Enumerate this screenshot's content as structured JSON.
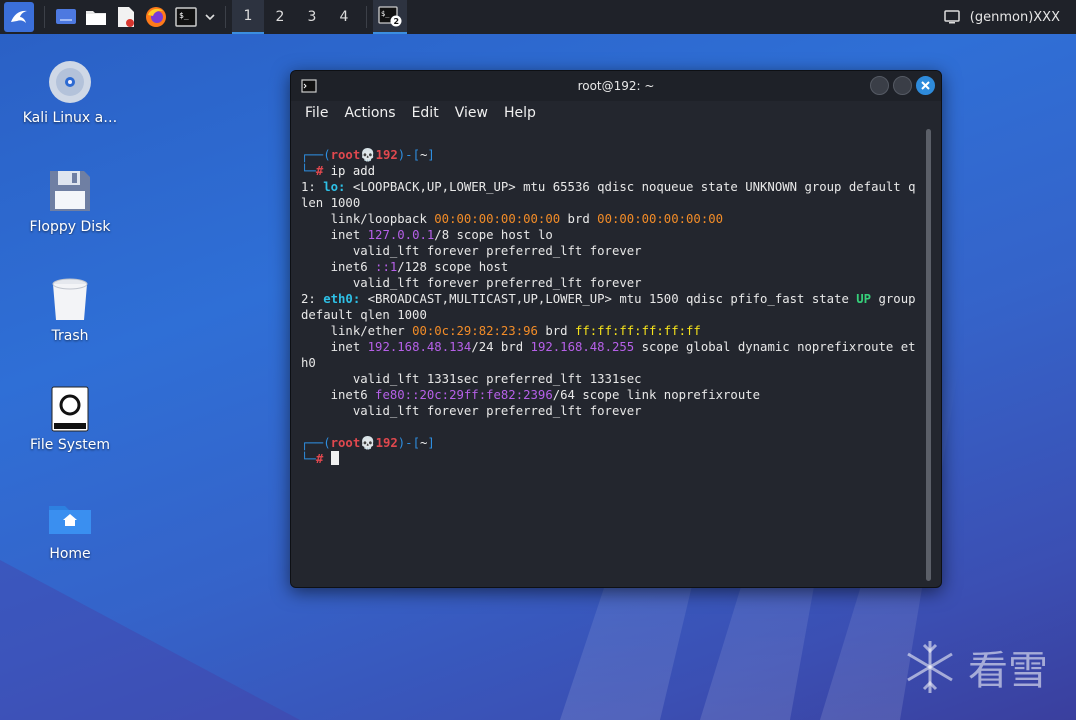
{
  "taskbar": {
    "workspaces": [
      "1",
      "2",
      "3",
      "4"
    ],
    "active_workspace": "1",
    "terminal_badge": "2",
    "genmon_label": "(genmon)XXX"
  },
  "desktop": {
    "icons": [
      {
        "label": "Kali Linux a…"
      },
      {
        "label": "Floppy Disk"
      },
      {
        "label": "Trash"
      },
      {
        "label": "File System"
      },
      {
        "label": "Home"
      }
    ]
  },
  "terminal": {
    "title": "root@192: ~",
    "menu": [
      "File",
      "Actions",
      "Edit",
      "View",
      "Help"
    ],
    "prompt_user": "root",
    "prompt_host": "192",
    "prompt_dir": "~",
    "command": "ip add",
    "lines": {
      "l1_a": "1: ",
      "l1_if": "lo:",
      "l1_b": " <LOOPBACK,UP,LOWER_UP> mtu 65536 qdisc noqueue state UNKNOWN group default qlen 1000",
      "l2_a": "    link/loopback ",
      "l2_mac": "00:00:00:00:00:00",
      "l2_b": " brd ",
      "l2_brd": "00:00:00:00:00:00",
      "l3_a": "    inet ",
      "l3_ip": "127.0.0.1",
      "l3_b": "/8 scope host lo",
      "l4": "       valid_lft forever preferred_lft forever",
      "l5_a": "    inet6 ",
      "l5_ip": "::1",
      "l5_b": "/128 scope host",
      "l6": "       valid_lft forever preferred_lft forever",
      "l7_a": "2: ",
      "l7_if": "eth0:",
      "l7_b": " <BROADCAST,MULTICAST,UP,LOWER_UP> mtu 1500 qdisc pfifo_fast state ",
      "l7_state": "UP",
      "l7_c": " group default qlen 1000",
      "l8_a": "    link/ether ",
      "l8_mac": "00:0c:29:82:23:96",
      "l8_b": " brd ",
      "l8_brd": "ff:ff:ff:ff:ff:ff",
      "l9_a": "    inet ",
      "l9_ip": "192.168.48.134",
      "l9_b": "/24 brd ",
      "l9_brd": "192.168.48.255",
      "l9_c": " scope global dynamic noprefixroute eth0",
      "l10": "       valid_lft 1331sec preferred_lft 1331sec",
      "l11_a": "    inet6 ",
      "l11_ip": "fe80::20c:29ff:fe82:2396",
      "l11_b": "/64 scope link noprefixroute",
      "l12": "       valid_lft forever preferred_lft forever"
    }
  },
  "watermark": {
    "text": "看雪"
  },
  "colors": {
    "prompt_frame": "#2e8ee0",
    "prompt_user": "#e0484e",
    "mac": "#f28c28",
    "ip": "#b660e8",
    "interface": "#2ec0e6",
    "state_up": "#36d07a"
  }
}
